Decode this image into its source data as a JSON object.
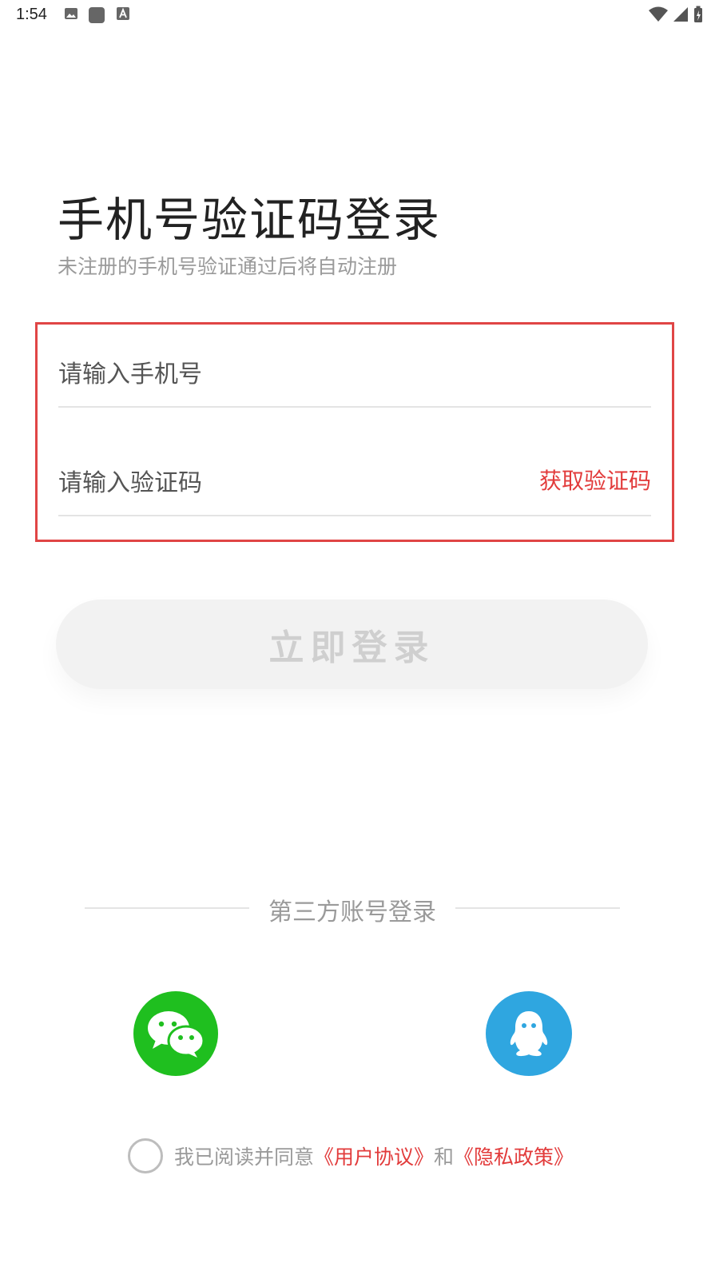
{
  "status_bar": {
    "time": "1:54",
    "icons_left": [
      "image-icon",
      "app-square-icon",
      "font-a-icon"
    ],
    "icons_right": [
      "wifi-icon",
      "signal-icon",
      "battery-charging-icon"
    ]
  },
  "header": {
    "title": "手机号验证码登录",
    "subtitle": "未注册的手机号验证通过后将自动注册"
  },
  "form": {
    "phone_placeholder": "请输入手机号",
    "code_placeholder": "请输入验证码",
    "get_code_label": "获取验证码"
  },
  "login_button": {
    "label": "立即登录"
  },
  "third_party": {
    "label": "第三方账号登录",
    "providers": [
      "wechat-icon",
      "qq-icon"
    ]
  },
  "agreement": {
    "prefix": "我已阅读并同意",
    "user_agreement": "《用户协议》",
    "and": "和",
    "privacy_policy": "《隐私政策》",
    "checked": false
  },
  "colors": {
    "accent": "#e23b3b",
    "wechat": "#1fbf1f",
    "qq": "#2fa6e0",
    "button_bg": "#f2f2f2",
    "button_text": "#cfcfcf"
  }
}
